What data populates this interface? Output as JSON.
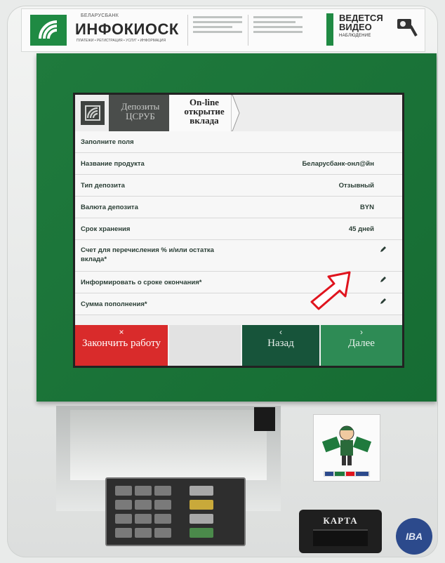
{
  "banner": {
    "bank": "БЕЛАРУСБАНК",
    "brand": "ИНФОКИОСК",
    "brand_sub": "ПЛАТЕЖИ • РЕГИСТРАЦИЯ • УСЛУГ • ИНФОРМАЦИЯ",
    "video_line1": "ВЕДЕТСЯ",
    "video_line2": "ВИДЕО",
    "video_line3": "НАБЛЮДЕНИЕ"
  },
  "screen": {
    "breadcrumb": [
      "Депозиты ЦСРУБ",
      "On-line открытие вклада"
    ],
    "rows": [
      {
        "label": "Заполните поля",
        "value": ""
      },
      {
        "label": "Название продукта",
        "value": "Беларусбанк-онл@йн"
      },
      {
        "label": "Тип депозита",
        "value": "Отзывный"
      },
      {
        "label": "Валюта депозита",
        "value": "BYN"
      },
      {
        "label": "Срок хранения",
        "value": "45 дней"
      },
      {
        "label": "Счет для перечисления % и/или остатка вклада*",
        "value": ""
      },
      {
        "label": "Информировать о сроке окончания*",
        "value": ""
      },
      {
        "label": "Сумма пополнения*",
        "value": ""
      }
    ],
    "buttons": {
      "finish_mark": "×",
      "finish": "Закончить работу",
      "back_mark": "‹",
      "back": "Назад",
      "next_mark": "›",
      "next": "Далее"
    }
  },
  "kiosk": {
    "card_label": "КАРТА",
    "vendor": "IBA"
  },
  "colors": {
    "bezel_green": "#1f7a3d",
    "finish_red": "#d92b2b",
    "back_dark_green": "#17543a",
    "next_green": "#2e8b55"
  }
}
